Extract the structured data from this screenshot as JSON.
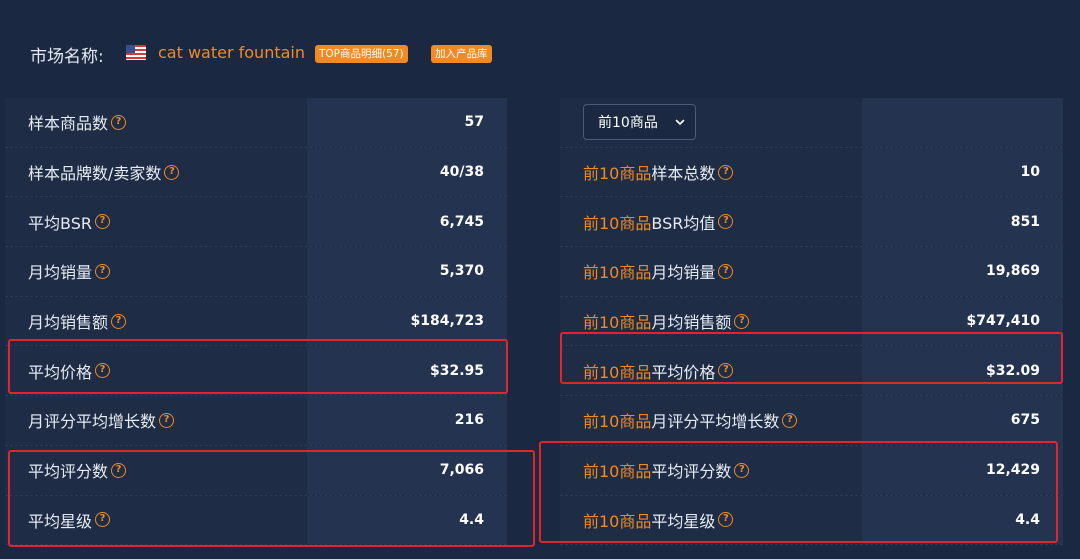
{
  "header": {
    "market_label": "市场名称:",
    "market_name": "cat water fountain",
    "top_tag": "TOP商品明细(57)",
    "add_tag": "加入产品库"
  },
  "left": [
    {
      "label": "样本商品数",
      "value": "57"
    },
    {
      "label": "样本品牌数/卖家数",
      "value": "40/38"
    },
    {
      "label": "平均BSR",
      "value": "6,745"
    },
    {
      "label": "月均销量",
      "value": "5,370"
    },
    {
      "label": "月均销售额",
      "value": "$184,723"
    },
    {
      "label": "平均价格",
      "value": "$32.95"
    },
    {
      "label": "月评分平均增长数",
      "value": "216"
    },
    {
      "label": "平均评分数",
      "value": "7,066"
    },
    {
      "label": "平均星级",
      "value": "4.4"
    }
  ],
  "right": {
    "select_value": "前10商品",
    "prefix": "前10商品",
    "rows": [
      {
        "label": "样本总数",
        "value": "10"
      },
      {
        "label": "BSR均值",
        "value": "851"
      },
      {
        "label": "月均销量",
        "value": "19,869"
      },
      {
        "label": "月均销售额",
        "value": "$747,410"
      },
      {
        "label": "平均价格",
        "value": "$32.09"
      },
      {
        "label": "月评分平均增长数",
        "value": "675"
      },
      {
        "label": "平均评分数",
        "value": "12,429"
      },
      {
        "label": "平均星级",
        "value": "4.4"
      }
    ]
  },
  "help_glyph": "?",
  "colors": {
    "accent": "#f08a24",
    "highlight": "#e0262b",
    "background": "#1b2841"
  }
}
